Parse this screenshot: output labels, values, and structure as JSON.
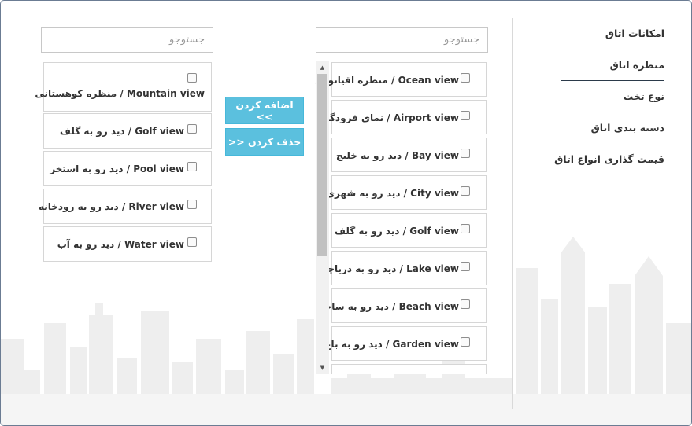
{
  "nav": {
    "items": [
      {
        "label": "امکانات اتاق",
        "active": false
      },
      {
        "label": "منظره اتاق",
        "active": true
      },
      {
        "label": "نوع تخت",
        "active": false
      },
      {
        "label": "دسته بندی اتاق",
        "active": false
      },
      {
        "label": "قیمت گذاری انواع اتاق",
        "active": false
      }
    ]
  },
  "available": {
    "search_placeholder": "جستوجو",
    "items": [
      {
        "label": "Ocean view / منظره اقیانوس"
      },
      {
        "label": "Airport view / نمای فرودگاه"
      },
      {
        "label": "Bay view / دید رو به خلیج"
      },
      {
        "label": "City view / دید رو به شهری"
      },
      {
        "label": "Golf view / دید رو به گلف"
      },
      {
        "label": "Lake view / دید رو به دریاچه"
      },
      {
        "label": "Beach view / دید رو به ساحل"
      },
      {
        "label": "Garden view / دید رو به باغ"
      }
    ]
  },
  "selected": {
    "search_placeholder": "جستوجو",
    "items": [
      {
        "label": "Mountain view / منظره کوهستانی"
      },
      {
        "label": "Golf view / دید رو به گلف"
      },
      {
        "label": "Pool view / دید رو به استخر"
      },
      {
        "label": "River view / دید رو به رودخانه"
      },
      {
        "label": "Water view / دید رو به آب"
      }
    ]
  },
  "buttons": {
    "add_label": "اضافه کردن >>",
    "remove_label": "حذف کردن <<"
  }
}
